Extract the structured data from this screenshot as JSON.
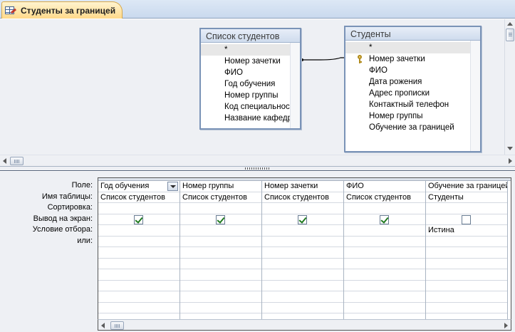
{
  "tab": {
    "title": "Студенты за границей",
    "icon": "query-design-icon"
  },
  "tables": [
    {
      "id": "list",
      "title": "Список студентов",
      "fields": [
        "*",
        "Номер зачетки",
        "ФИО",
        "Год обучения",
        "Номер группы",
        "Код специальности",
        "Название кафедры"
      ]
    },
    {
      "id": "students",
      "title": "Студенты",
      "key_field": "Номер зачетки",
      "fields": [
        "*",
        "Номер зачетки",
        "ФИО",
        "Дата рожения",
        "Адрес прописки",
        "Контактный телефон",
        "Номер группы",
        "Обучение за границей"
      ]
    }
  ],
  "grid": {
    "row_labels": [
      "Поле:",
      "Имя таблицы:",
      "Сортировка:",
      "Вывод на экран:",
      "Условие отбора:",
      "или:"
    ],
    "columns": [
      {
        "field": "Год обучения",
        "table": "Список студентов",
        "sort": "",
        "show": true,
        "criteria": "",
        "or": "",
        "dropdown": true
      },
      {
        "field": "Номер группы",
        "table": "Список студентов",
        "sort": "",
        "show": true,
        "criteria": "",
        "or": ""
      },
      {
        "field": "Номер зачетки",
        "table": "Список студентов",
        "sort": "",
        "show": true,
        "criteria": "",
        "or": ""
      },
      {
        "field": "ФИО",
        "table": "Список студентов",
        "sort": "",
        "show": true,
        "criteria": "",
        "or": ""
      },
      {
        "field": "Обучение за границей",
        "table": "Студенты",
        "sort": "",
        "show": false,
        "criteria": "Истина",
        "or": ""
      }
    ]
  }
}
